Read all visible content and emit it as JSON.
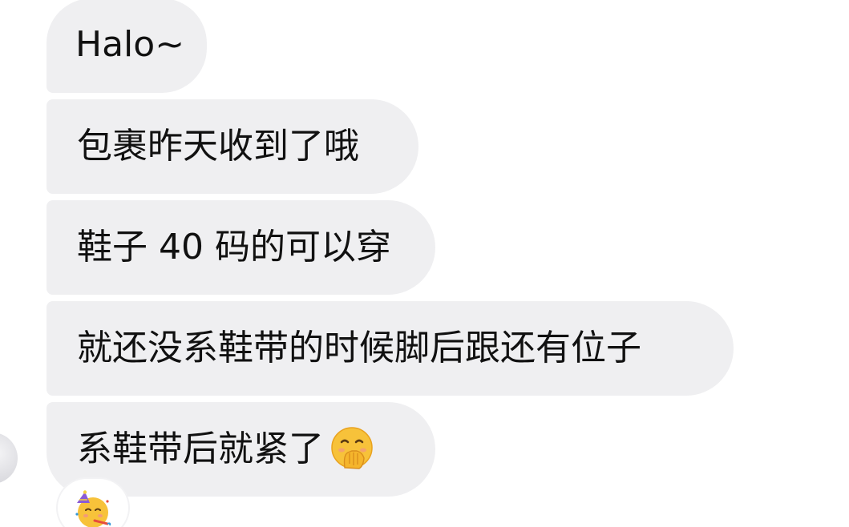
{
  "messages": [
    {
      "text": "Halo~"
    },
    {
      "text": "包裹昨天收到了哦"
    },
    {
      "text": "鞋子 40 码的可以穿"
    },
    {
      "text": "就还没系鞋带的时候脚后跟还有位子"
    },
    {
      "text": "系鞋带后就紧了",
      "emoji": "hand-over-mouth-emoji"
    }
  ],
  "reaction": {
    "emoji": "partying-face-emoji"
  },
  "colors": {
    "bubble_bg": "#efeff1",
    "text": "#111111",
    "emoji_face": "#f7c23a"
  }
}
